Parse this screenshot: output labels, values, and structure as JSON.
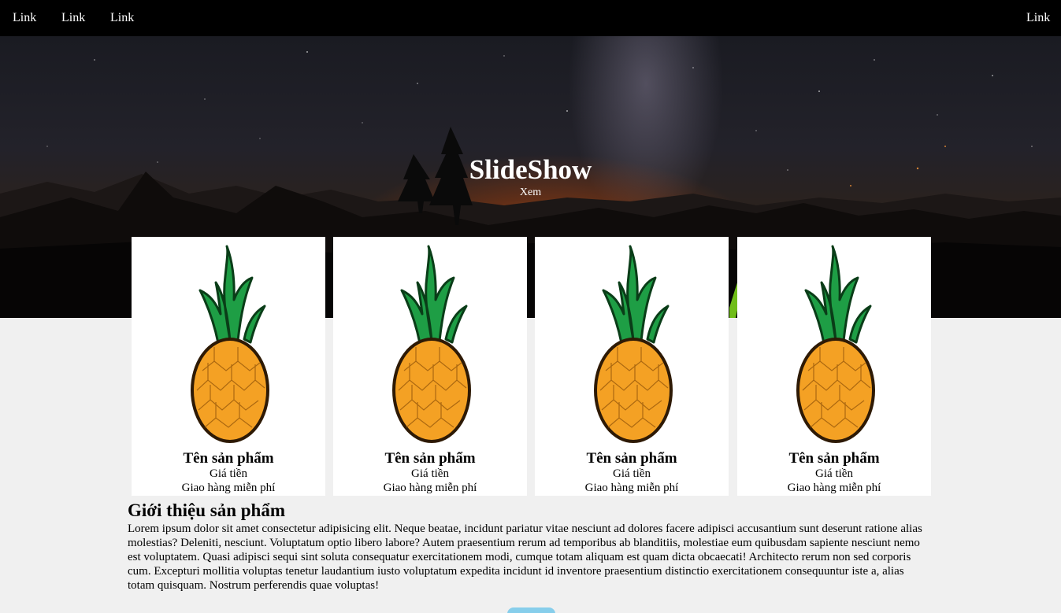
{
  "navbar": {
    "links": [
      "Link",
      "Link",
      "Link"
    ],
    "right_link": "Link"
  },
  "hero": {
    "title": "SlideShow",
    "subtitle": "Xem"
  },
  "products": [
    {
      "name": "Tên sản phẩm",
      "price": "Giá tiền",
      "shipping": "Giao hàng miễn phí",
      "icon": "pineapple-icon"
    },
    {
      "name": "Tên sản phẩm",
      "price": "Giá tiền",
      "shipping": "Giao hàng miễn phí",
      "icon": "pineapple-icon"
    },
    {
      "name": "Tên sản phẩm",
      "price": "Giá tiền",
      "shipping": "Giao hàng miễn phí",
      "icon": "pineapple-icon"
    },
    {
      "name": "Tên sản phẩm",
      "price": "Giá tiền",
      "shipping": "Giao hàng miễn phí",
      "icon": "pineapple-icon"
    }
  ],
  "intro": {
    "title": "Giới thiệu sản phẩm",
    "text": "Lorem ipsum dolor sit amet consectetur adipisicing elit. Neque beatae, incidunt pariatur vitae nesciunt ad dolores facere adipisci accusantium sunt deserunt ratione alias molestias? Deleniti, nesciunt. Voluptatum optio libero labore? Autem praesentium rerum ad temporibus ab blanditiis, molestiae eum quibusdam sapiente nesciunt nemo est voluptatem. Quasi adipisci sequi sint soluta consequatur exercitationem modi, cumque totam aliquam est quam dicta obcaecati! Architecto rerum non sed corporis cum. Excepturi mollitia voluptas tenetur laudantium iusto voluptatum expedita incidunt id inventore praesentium distinctio exercitationem consequuntur iste a, alias totam quisquam. Nostrum perferendis quae voluptas!"
  },
  "colors": {
    "navbar_bg": "#000000",
    "page_bg": "#f0f0f0",
    "button_accent": "#87ceeb"
  }
}
